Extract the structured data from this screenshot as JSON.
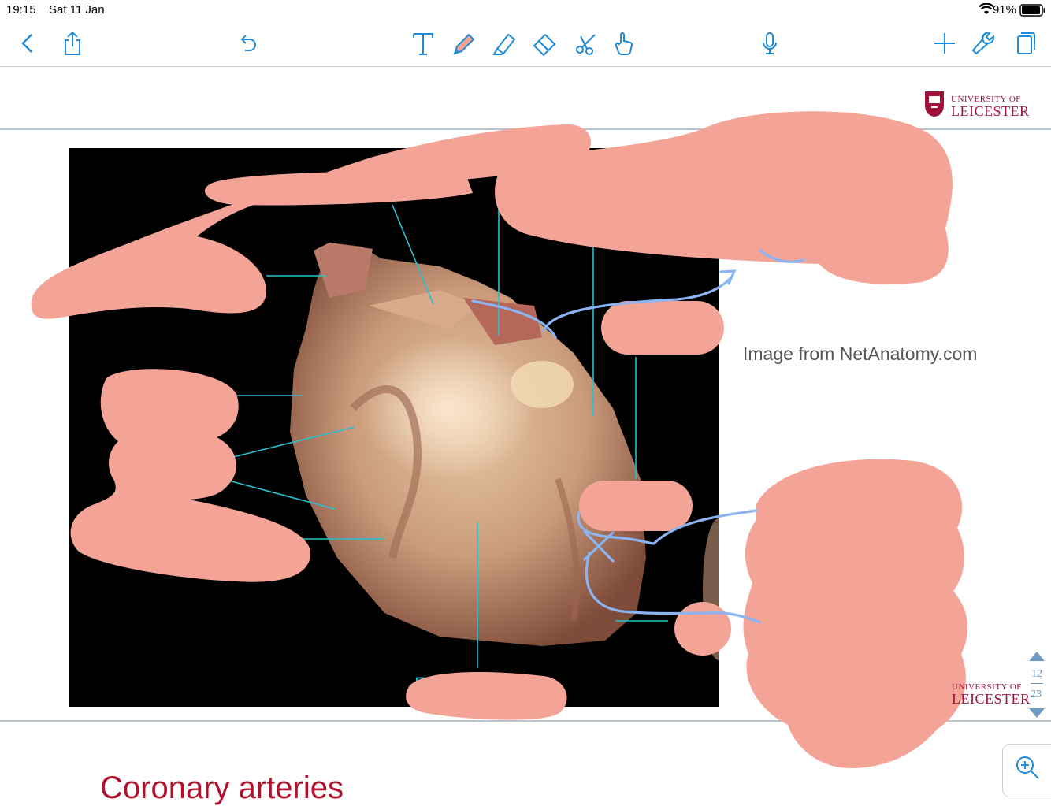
{
  "status_bar": {
    "time": "19:15",
    "date": "Sat 11 Jan",
    "battery": "91%"
  },
  "toolbar": {
    "icons": [
      "back-icon",
      "share-icon",
      "undo-icon",
      "text-tool-icon",
      "pen-icon",
      "highlighter-icon",
      "eraser-icon",
      "lasso-icon",
      "pointer-hand-icon",
      "microphone-icon",
      "add-page-icon",
      "settings-wrench-icon",
      "pages-icon"
    ]
  },
  "slide": {
    "logo_top": {
      "line1": "UNIVERSITY OF",
      "line2": "LEICESTER"
    },
    "logo_bottom": {
      "line1": "UNIVERSITY OF",
      "line2": "LEICESTER"
    },
    "image_credit": "Image from NetAnatomy.com",
    "partial_label": "R"
  },
  "next_slide": {
    "title": "Coronary arteries"
  },
  "page_nav": {
    "current": "12",
    "total": "23"
  },
  "colors": {
    "accent": "#1f8ad6",
    "annotation_pink": "#f4a497",
    "label_line": "#25c2d0",
    "pen_blue": "#8ab4f2",
    "logo_red": "#a0123a"
  }
}
